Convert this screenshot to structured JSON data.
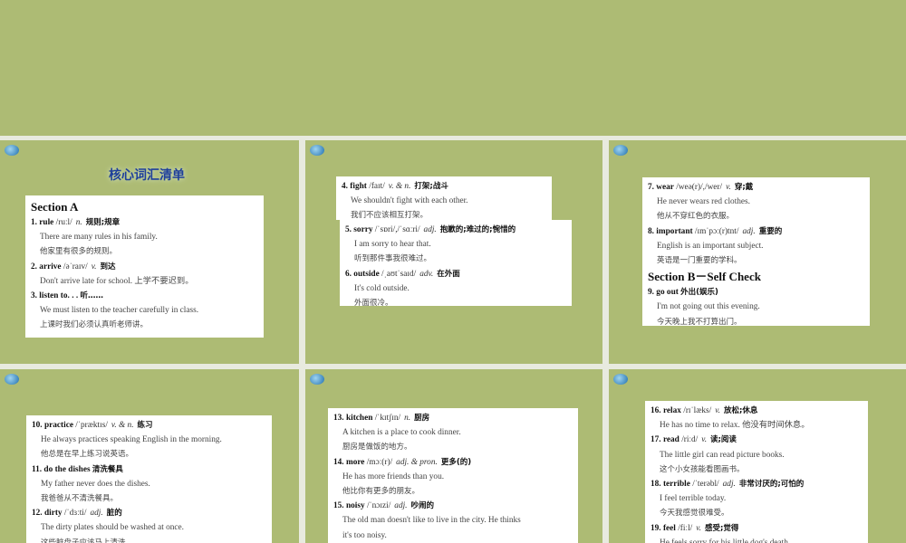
{
  "slides": [
    {
      "title": "核心词汇清单",
      "boxes": [
        {
          "lines": [
            {
              "k": "section",
              "t": "Section A"
            },
            {
              "k": "head",
              "w": "1. rule",
              "p": "/ruːl/",
              "pos": "n.",
              "cn": "规则;规章"
            },
            {
              "k": "en",
              "t": "There are many rules in his family."
            },
            {
              "k": "zh",
              "t": "他家里有很多的规则。"
            },
            {
              "k": "head",
              "w": "2. arrive",
              "p": "/əˈraɪv/",
              "pos": "v.",
              "cn": "到达"
            },
            {
              "k": "en",
              "t": "Don't arrive late for school. 上学不要迟到。"
            },
            {
              "k": "head",
              "w": "3. listen to. . .",
              "p": "",
              "pos": "",
              "cn": "听……"
            },
            {
              "k": "en",
              "t": "We must listen to the teacher carefully in class."
            },
            {
              "k": "zh",
              "t": "上课时我们必须认真听老师讲。"
            }
          ]
        }
      ]
    },
    {
      "boxes": [
        {
          "lines": [
            {
              "k": "head",
              "w": "4. fight",
              "p": "/faɪt/",
              "pos": "v. & n.",
              "cn": "打架;战斗"
            },
            {
              "k": "en",
              "t": "We shouldn't fight with each other."
            },
            {
              "k": "zh",
              "t": "我们不应该相互打架。"
            }
          ]
        },
        {
          "lines": [
            {
              "k": "head",
              "w": "5. sorry",
              "p": "/ˈsɒri/,/ˈsɑːri/",
              "pos": "adj.",
              "cn": "抱歉的;难过的;惋惜的"
            },
            {
              "k": "en",
              "t": "I am sorry to hear that."
            },
            {
              "k": "zh",
              "t": "听到那件事我很难过。"
            },
            {
              "k": "head",
              "w": "6. outside",
              "p": "/ˌaʊtˈsaɪd/",
              "pos": "adv.",
              "cn": "在外面"
            },
            {
              "k": "en",
              "t": "It's cold outside."
            },
            {
              "k": "zh",
              "t": "外面很冷。"
            }
          ]
        }
      ]
    },
    {
      "boxes": [
        {
          "lines": [
            {
              "k": "head",
              "w": "7. wear",
              "p": "/weə(r)/,/wer/",
              "pos": "v.",
              "cn": "穿;戴"
            },
            {
              "k": "en",
              "t": "He never wears red clothes."
            },
            {
              "k": "zh",
              "t": "他从不穿红色的衣服。"
            },
            {
              "k": "head",
              "w": "8. important",
              "p": "/ɪmˈpɔː(r)tnt/",
              "pos": "adj.",
              "cn": "重要的"
            },
            {
              "k": "en",
              "t": "English is an important subject."
            },
            {
              "k": "zh",
              "t": "英语是一门重要的学科。"
            },
            {
              "k": "section",
              "t": "Section B－Self Check"
            },
            {
              "k": "head",
              "w": "9. go out",
              "p": "",
              "pos": "",
              "cn": "外出(娱乐)"
            },
            {
              "k": "en",
              "t": "I'm not going out this evening."
            },
            {
              "k": "zh",
              "t": "今天晚上我不打算出门。"
            }
          ]
        }
      ]
    },
    {
      "boxes": [
        {
          "lines": [
            {
              "k": "head",
              "w": "10. practice",
              "p": "/ˈpræktɪs/",
              "pos": "v. & n.",
              "cn": "练习"
            },
            {
              "k": "en",
              "t": "He always practices speaking English in the morning."
            },
            {
              "k": "zh",
              "t": "他总是在早上练习说英语。"
            },
            {
              "k": "head",
              "w": "11. do the dishes",
              "p": "",
              "pos": "",
              "cn": "清洗餐具"
            },
            {
              "k": "en",
              "t": "My father never does the dishes."
            },
            {
              "k": "zh",
              "t": "我爸爸从不清洗餐具。"
            },
            {
              "k": "head",
              "w": "12. dirty",
              "p": "/ˈdɜːti/",
              "pos": "adj.",
              "cn": "脏的"
            },
            {
              "k": "en",
              "t": "The dirty plates should be washed at once."
            },
            {
              "k": "zh",
              "t": "这些脏盘子应该马上清洗。"
            }
          ]
        }
      ]
    },
    {
      "boxes": [
        {
          "lines": [
            {
              "k": "head",
              "w": "13. kitchen",
              "p": "/ˈkɪtʃɪn/",
              "pos": "n.",
              "cn": "厨房"
            },
            {
              "k": "en",
              "t": "A kitchen is a place to cook dinner."
            },
            {
              "k": "zh",
              "t": "厨房是做饭的地方。"
            },
            {
              "k": "head",
              "w": "14. more",
              "p": "/mɔː(r)/",
              "pos": "adj. & pron.",
              "cn": "更多(的)"
            },
            {
              "k": "en",
              "t": "He has more friends than you."
            },
            {
              "k": "zh",
              "t": "他比你有更多的朋友。"
            },
            {
              "k": "head",
              "w": "15. noisy",
              "p": "/ˈnɔɪzi/",
              "pos": "adj.",
              "cn": "吵闹的"
            },
            {
              "k": "en",
              "t": "The old man doesn't like to live in the city. He thinks"
            },
            {
              "k": "en",
              "t": "it's too noisy."
            }
          ]
        }
      ]
    },
    {
      "boxes": [
        {
          "lines": [
            {
              "k": "head",
              "w": "16. relax",
              "p": "/rɪˈlæks/",
              "pos": "v.",
              "cn": "放松;休息"
            },
            {
              "k": "en",
              "t": "He has no time to relax. 他没有时间休息。"
            },
            {
              "k": "head",
              "w": "17. read",
              "p": "/riːd/",
              "pos": "v.",
              "cn": "读;阅读"
            },
            {
              "k": "en",
              "t": "The little girl can read picture books."
            },
            {
              "k": "zh",
              "t": "这个小女孩能看图画书。"
            },
            {
              "k": "head",
              "w": "18. terrible",
              "p": "/ˈterəbl/",
              "pos": "adj.",
              "cn": "非常讨厌的;可怕的"
            },
            {
              "k": "en",
              "t": "I feel terrible today."
            },
            {
              "k": "zh",
              "t": "今天我感觉很难受。"
            },
            {
              "k": "head",
              "w": "19. feel",
              "p": "/fiːl/",
              "pos": "v.",
              "cn": "感受;觉得"
            },
            {
              "k": "en",
              "t": "He feels sorry for his little dog's death."
            }
          ]
        }
      ]
    }
  ]
}
